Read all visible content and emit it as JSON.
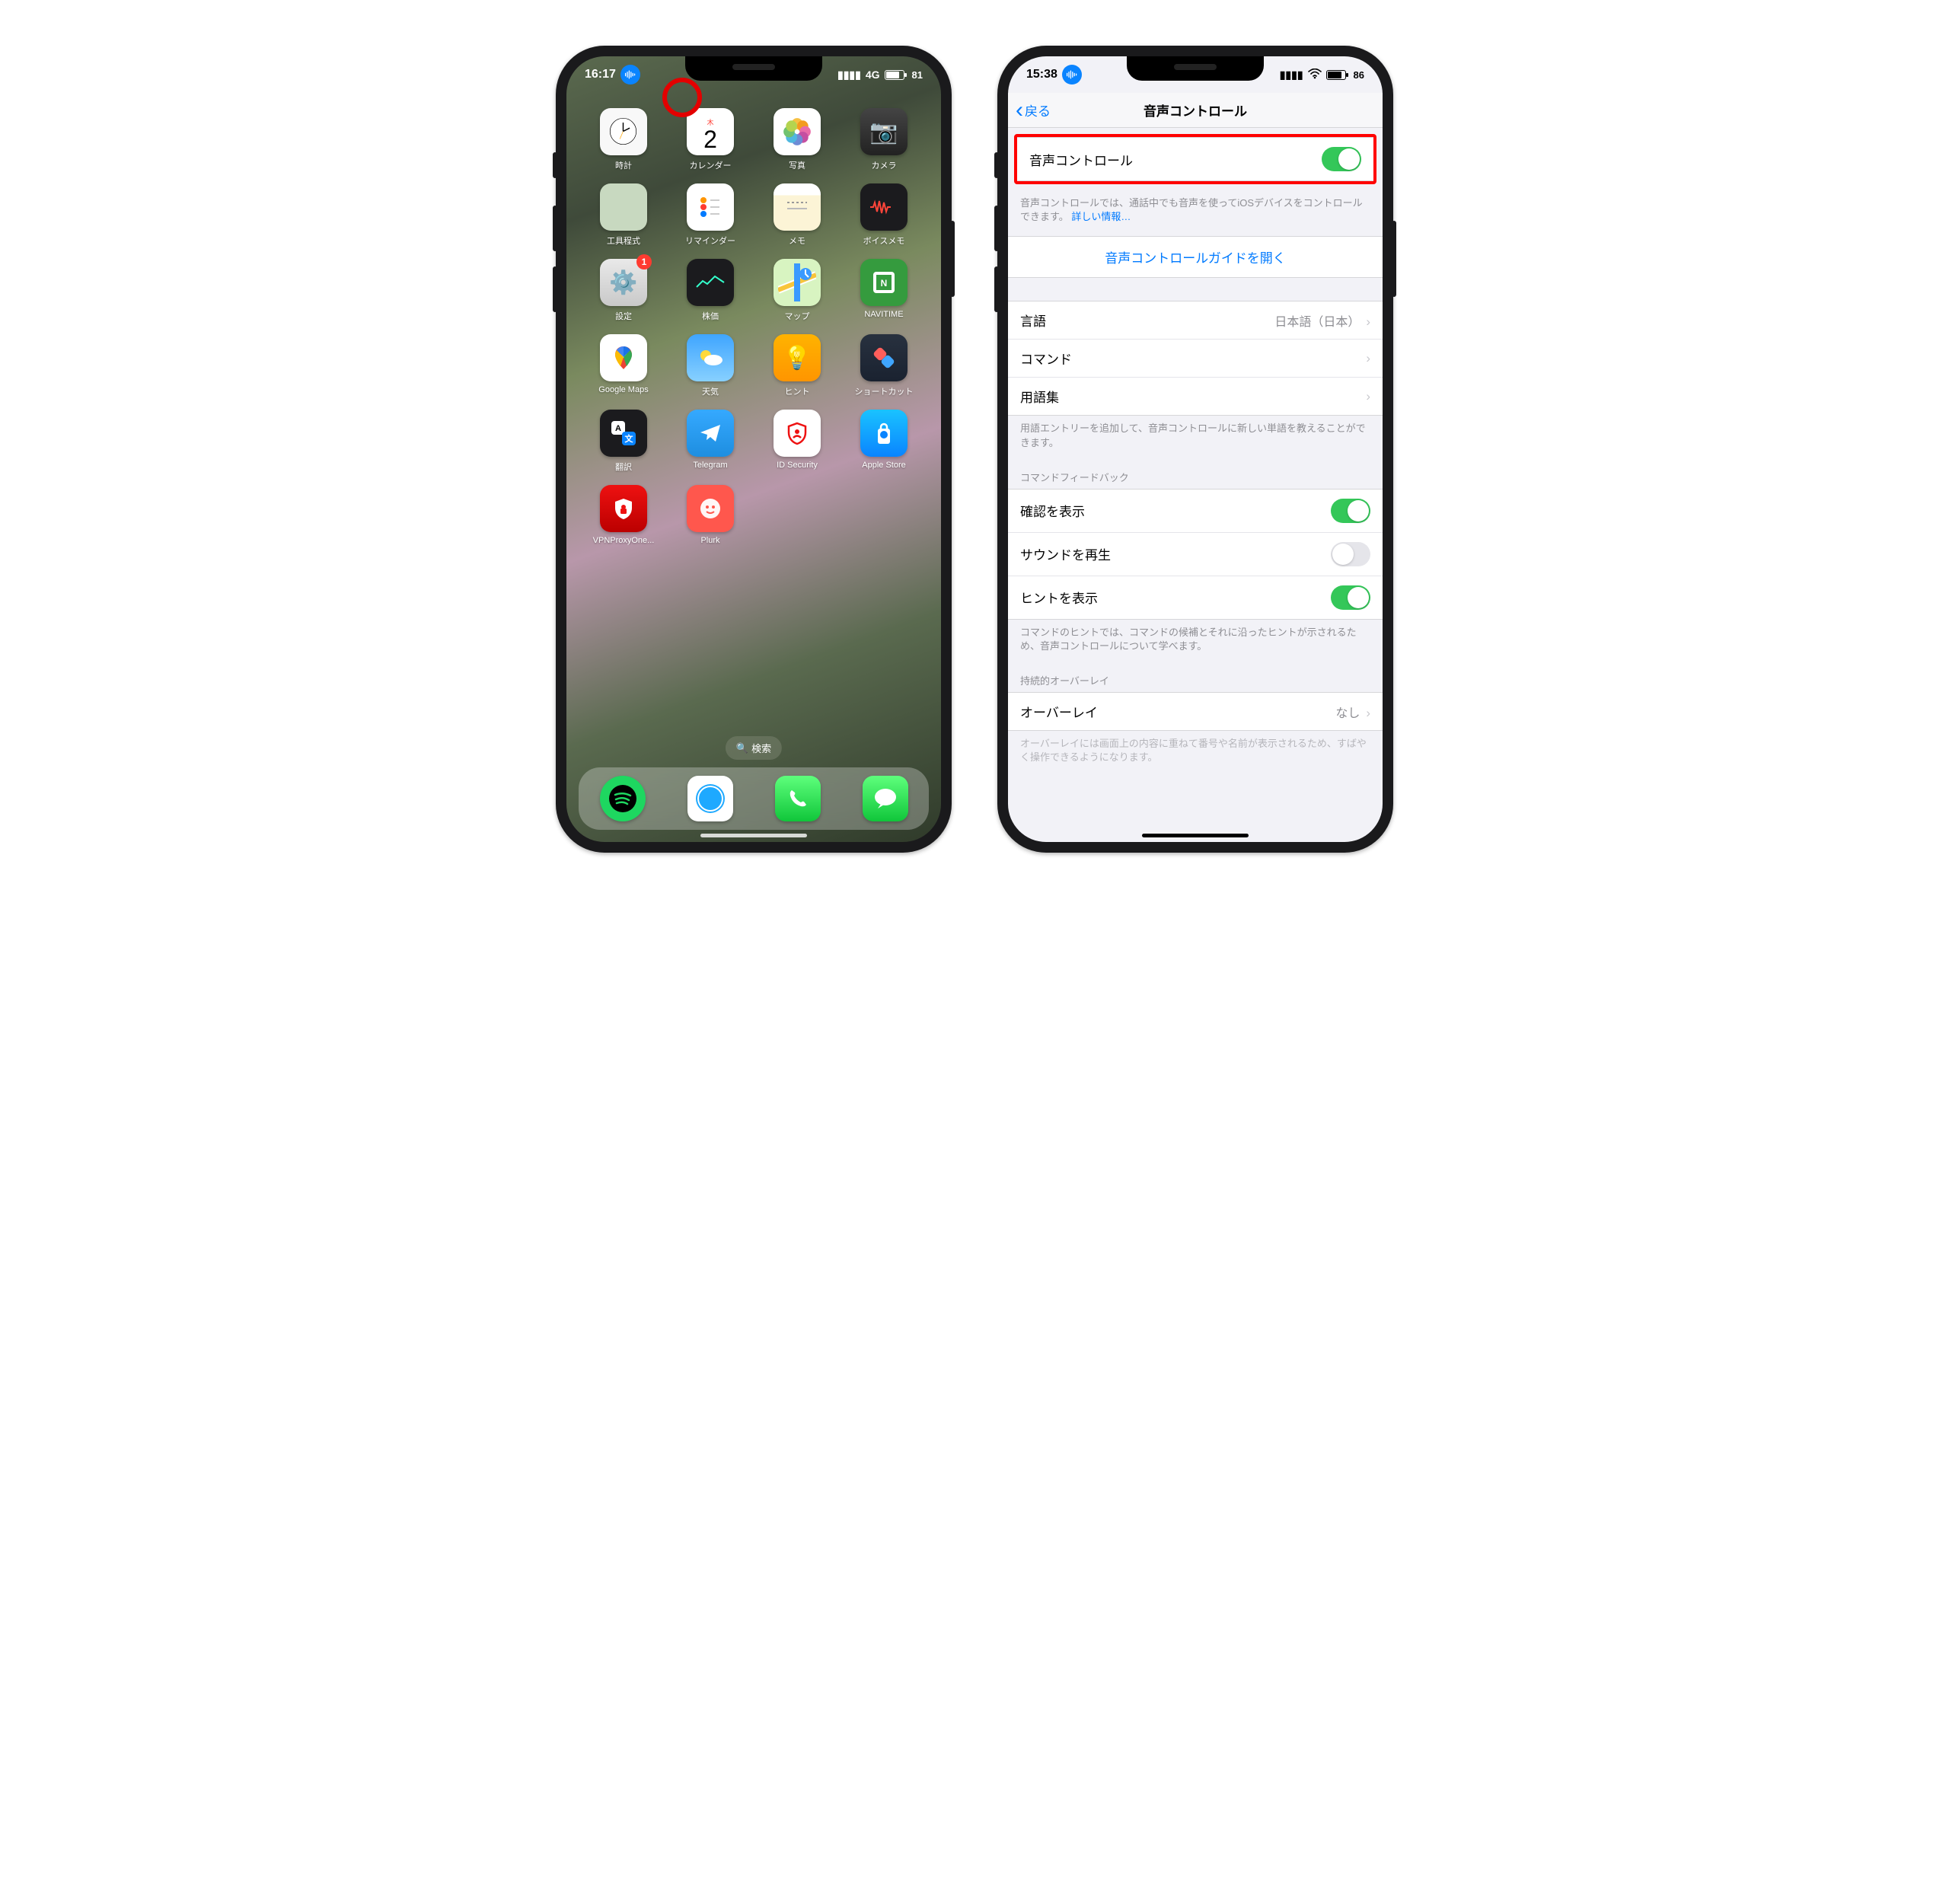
{
  "left": {
    "status": {
      "time": "16:17",
      "net": "4G",
      "battery": 81
    },
    "apps": [
      {
        "label": "時計",
        "icon": "clock"
      },
      {
        "label": "カレンダー",
        "icon": "cal",
        "day": "2",
        "dow": "木"
      },
      {
        "label": "写真",
        "icon": "photos"
      },
      {
        "label": "カメラ",
        "icon": "camera"
      },
      {
        "label": "工具程式",
        "icon": "emacs"
      },
      {
        "label": "リマインダー",
        "icon": "reminder"
      },
      {
        "label": "メモ",
        "icon": "notes"
      },
      {
        "label": "ボイスメモ",
        "icon": "voice"
      },
      {
        "label": "設定",
        "icon": "settings",
        "badge": 1
      },
      {
        "label": "株価",
        "icon": "stocks"
      },
      {
        "label": "マップ",
        "icon": "maps"
      },
      {
        "label": "NAVITIME",
        "icon": "navitime"
      },
      {
        "label": "Google Maps",
        "icon": "gmaps"
      },
      {
        "label": "天気",
        "icon": "weather"
      },
      {
        "label": "ヒント",
        "icon": "tips"
      },
      {
        "label": "ショートカット",
        "icon": "shortcut"
      },
      {
        "label": "翻訳",
        "icon": "translate"
      },
      {
        "label": "Telegram",
        "icon": "telegram"
      },
      {
        "label": "ID Security",
        "icon": "idsec"
      },
      {
        "label": "Apple Store",
        "icon": "appstore"
      },
      {
        "label": "VPNProxyOne...",
        "icon": "vpn"
      },
      {
        "label": "Plurk",
        "icon": "plurk"
      }
    ],
    "search": "検索",
    "dock": [
      "spotify",
      "safari",
      "phone",
      "msg"
    ]
  },
  "right": {
    "status": {
      "time": "15:38",
      "battery": 86
    },
    "nav": {
      "back": "戻る",
      "title": "音声コントロール"
    },
    "main_toggle": {
      "label": "音声コントロール",
      "on": true
    },
    "main_footer": "音声コントロールでは、通話中でも音声を使ってiOSデバイスをコントロールできます。",
    "main_footer_link": "詳しい情報…",
    "guide_link": "音声コントロールガイドを開く",
    "rows": {
      "lang_label": "言語",
      "lang_value": "日本語（日本）",
      "cmd": "コマンド",
      "vocab": "用語集"
    },
    "vocab_footer": "用語エントリーを追加して、音声コントロールに新しい単語を教えることができます。",
    "feedback_header": "コマンドフィードバック",
    "feedback": [
      {
        "label": "確認を表示",
        "on": true
      },
      {
        "label": "サウンドを再生",
        "on": false
      },
      {
        "label": "ヒントを表示",
        "on": true
      }
    ],
    "feedback_footer": "コマンドのヒントでは、コマンドの候補とそれに沿ったヒントが示されるため、音声コントロールについて学べます。",
    "overlay_header": "持続的オーバーレイ",
    "overlay": {
      "label": "オーバーレイ",
      "value": "なし"
    },
    "overlay_footer": "オーバーレイには画面上の内容に重ねて番号や名前が表示されるため、すばやく操作できるようになります。"
  }
}
